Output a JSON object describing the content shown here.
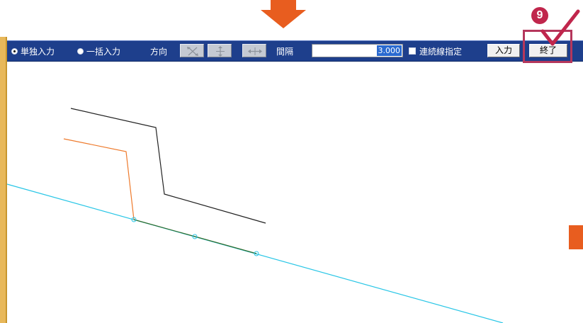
{
  "toolbar": {
    "mode_single_label": "単独入力",
    "mode_batch_label": "一括入力",
    "mode_selected": "単独入力",
    "direction_label": "方向",
    "direction_buttons": [
      "diagonal-arrows-icon",
      "vertical-arrows-icon",
      "horizontal-arrows-icon"
    ],
    "spacing_label": "間隔",
    "spacing_value": "3.000",
    "continuous_line_label": "連続線指定",
    "continuous_line_checked": false,
    "input_button_label": "入力",
    "finish_button_label": "終了"
  },
  "annotation": {
    "step_number": "9",
    "highlight_color": "#b5375c",
    "badge_color": "#c0264c"
  },
  "colors": {
    "toolbar_bg": "#1e3f8c",
    "arrow": "#e85d1f",
    "cyan_line": "#29c6e6",
    "orange_line": "#ee7a2c",
    "black_line": "#222222",
    "green_line": "#2f6b2a"
  }
}
